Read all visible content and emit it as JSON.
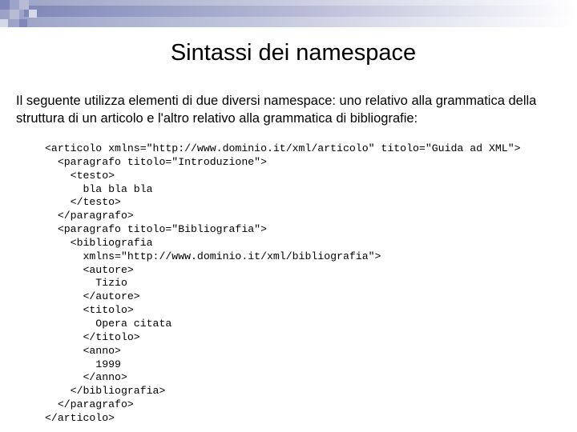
{
  "slide": {
    "title": "Sintassi dei namespace",
    "intro": "Il seguente utilizza elementi di due diversi namespace: uno relativo alla grammatica della struttura di un articolo e l'altro relativo alla grammatica di bibliografie:",
    "code_lines": [
      "<articolo xmlns=\"http://www.dominio.it/xml/articolo\" titolo=\"Guida ad XML\">",
      "  <paragrafo titolo=\"Introduzione\">",
      "    <testo>",
      "      bla bla bla",
      "    </testo>",
      "  </paragrafo>",
      "  <paragrafo titolo=\"Bibliografia\">",
      "    <bibliografia",
      "      xmlns=\"http://www.dominio.it/xml/bibliografia\">",
      "      <autore>",
      "        Tizio",
      "      </autore>",
      "      <titolo>",
      "        Opera citata",
      "      </titolo>",
      "      <anno>",
      "        1999",
      "      </anno>",
      "    </bibliografia>",
      "  </paragrafo>",
      "</articolo>"
    ]
  }
}
